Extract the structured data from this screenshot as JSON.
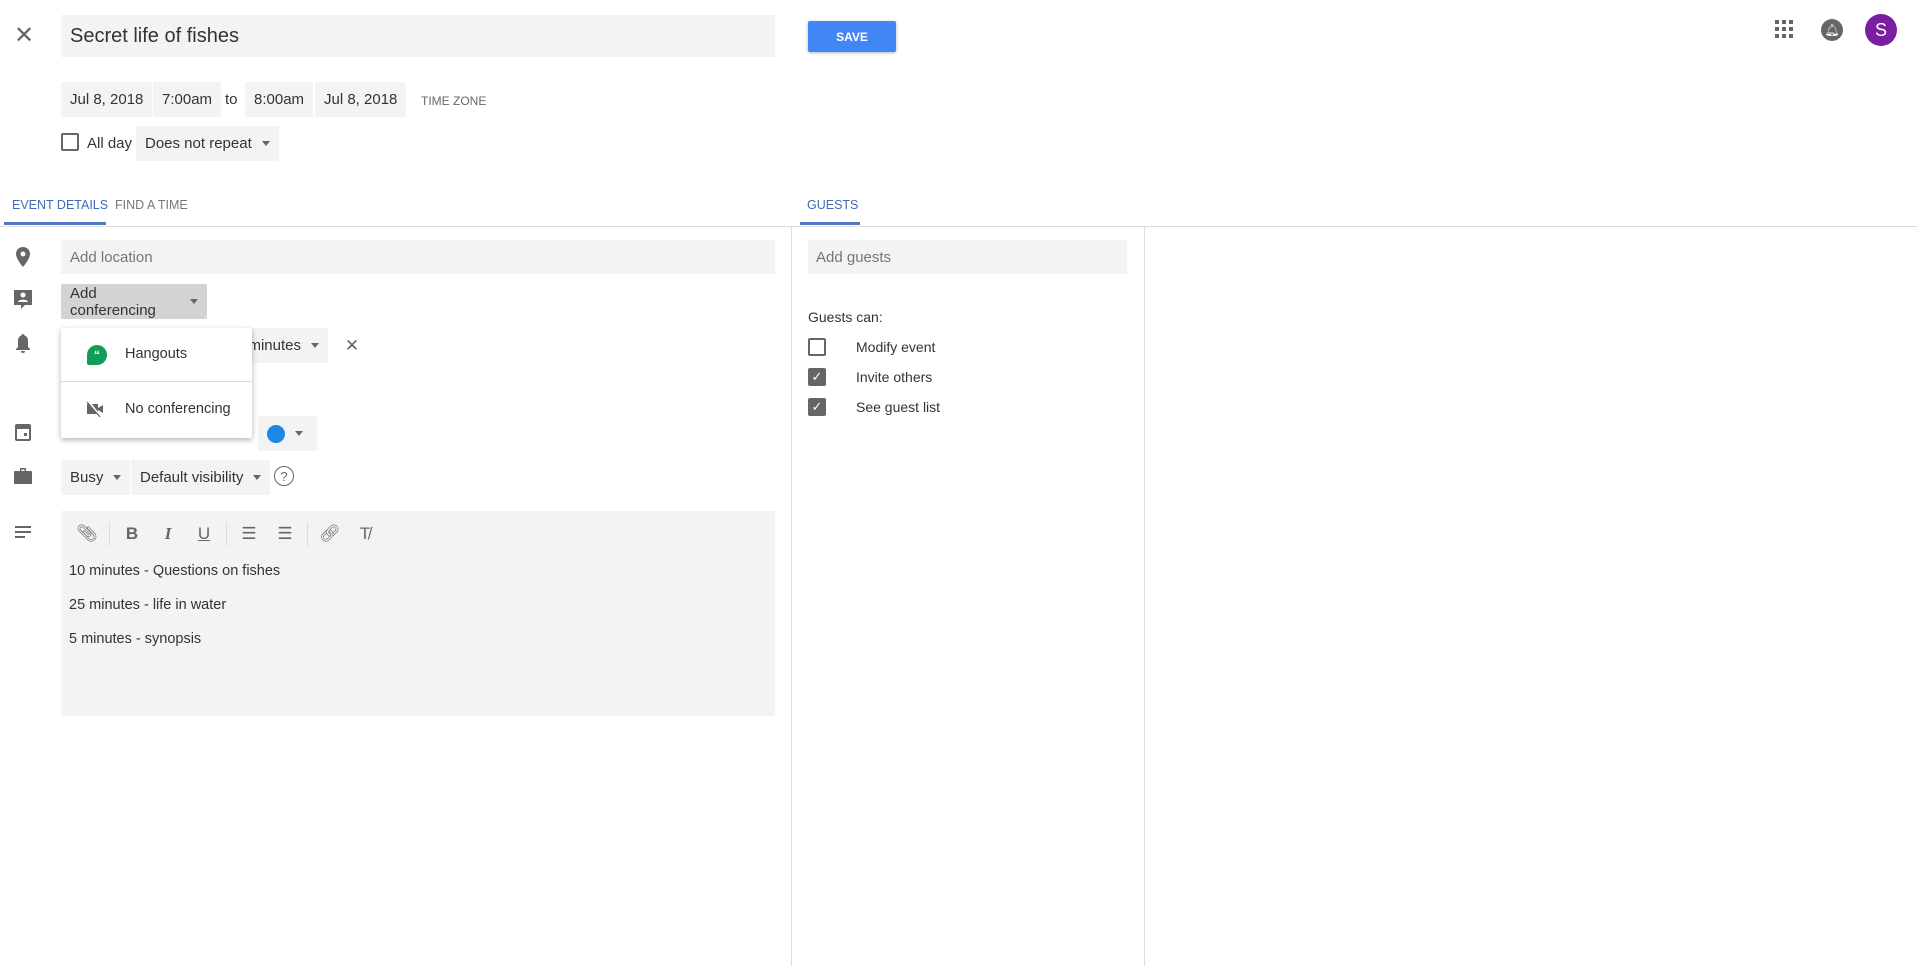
{
  "header": {
    "title": "Secret life of fishes",
    "save_label": "SAVE",
    "avatar_letter": "S"
  },
  "datetime": {
    "start_date": "Jul 8, 2018",
    "start_time": "7:00am",
    "to": "to",
    "end_time": "8:00am",
    "end_date": "Jul 8, 2018",
    "time_zone": "TIME ZONE",
    "all_day_label": "All day",
    "all_day_checked": false,
    "repeat": "Does not repeat"
  },
  "tabs": {
    "event_details": "EVENT DETAILS",
    "find_a_time": "FIND A TIME",
    "guests": "GUESTS"
  },
  "details": {
    "location_placeholder": "Add location",
    "conferencing": "Add conferencing",
    "notification_unit": "minutes",
    "calendar_color": "#1e88e5",
    "availability": "Busy",
    "visibility": "Default visibility",
    "description": [
      "10 minutes - Questions on fishes",
      "25 minutes - life in water",
      "5 minutes - synopsis"
    ]
  },
  "conferencing_menu": [
    {
      "label": "Hangouts",
      "icon": "hangouts-icon"
    },
    {
      "label": "No conferencing",
      "icon": "videocam-off-icon"
    }
  ],
  "guests": {
    "placeholder": "Add guests",
    "guests_can": "Guests can:",
    "permissions": [
      {
        "label": "Modify event",
        "checked": false
      },
      {
        "label": "Invite others",
        "checked": true
      },
      {
        "label": "See guest list",
        "checked": true
      }
    ]
  },
  "colors": {
    "accent": "#4285f4",
    "avatar": "#7b1fa2",
    "hangouts": "#0f9d58"
  }
}
